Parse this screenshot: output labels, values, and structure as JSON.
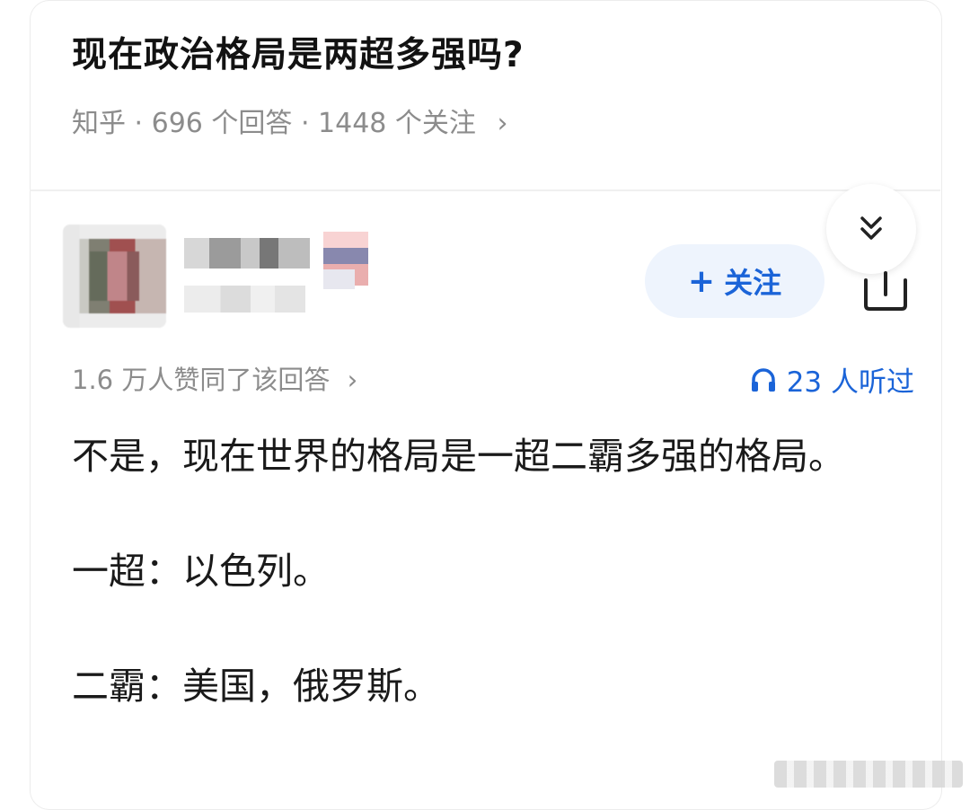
{
  "question": {
    "title": "现在政治格局是两超多强吗?",
    "source": "知乎",
    "answers": "696 个回答",
    "followers": "1448 个关注"
  },
  "author": {
    "follow_label": "关注"
  },
  "answer": {
    "votes_text": "1.6 万人赞同了该回答",
    "listen_count": "23 人听过",
    "paragraphs": [
      "不是，现在世界的格局是一超二霸多强的格局。",
      "一超：以色列。",
      "二霸：美国，俄罗斯。"
    ]
  },
  "icons": {
    "collapse": "double-chevron-down-icon",
    "share": "share-icon",
    "headphones": "headphones-icon"
  },
  "colors": {
    "accent": "#1b64d8",
    "muted": "#8c8c8c",
    "follow_bg": "#eef4fd"
  }
}
